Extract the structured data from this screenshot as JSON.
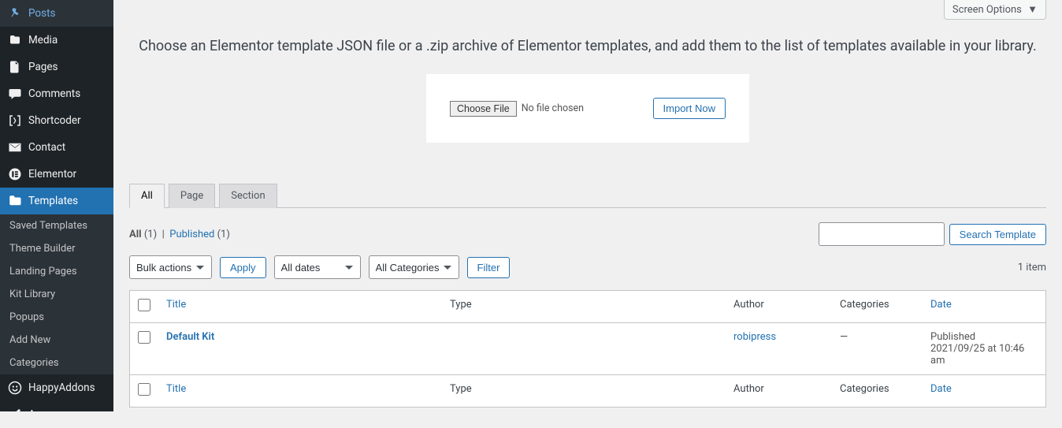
{
  "screen_options": "Screen Options",
  "sidebar": {
    "items": [
      {
        "icon": "pin",
        "label": "Posts"
      },
      {
        "icon": "media",
        "label": "Media"
      },
      {
        "icon": "page",
        "label": "Pages"
      },
      {
        "icon": "comment",
        "label": "Comments"
      },
      {
        "icon": "shortcoder",
        "label": "Shortcoder"
      },
      {
        "icon": "mail",
        "label": "Contact"
      },
      {
        "icon": "elementor",
        "label": "Elementor"
      },
      {
        "icon": "folder",
        "label": "Templates"
      },
      {
        "icon": "happy",
        "label": "HappyAddons"
      },
      {
        "icon": "brush",
        "label": "Appearance"
      }
    ],
    "submenu": [
      "Saved Templates",
      "Theme Builder",
      "Landing Pages",
      "Kit Library",
      "Popups",
      "Add New",
      "Categories"
    ]
  },
  "intro": "Choose an Elementor template JSON file or a .zip archive of Elementor templates, and add them to the list of templates available in your library.",
  "upload": {
    "choose_file": "Choose File",
    "no_file": "No file chosen",
    "import_btn": "Import Now"
  },
  "tabs": [
    {
      "label": "All",
      "active": true
    },
    {
      "label": "Page",
      "active": false
    },
    {
      "label": "Section",
      "active": false
    }
  ],
  "subsubs": {
    "all_label": "All",
    "all_count": "(1)",
    "sep": "|",
    "published_label": "Published",
    "published_count": "(1)"
  },
  "search": {
    "placeholder": "",
    "button": "Search Template"
  },
  "bulk": {
    "default": "Bulk actions",
    "apply": "Apply"
  },
  "filters": {
    "dates": "All dates",
    "cats": "All Categories",
    "filter_btn": "Filter"
  },
  "item_count": "1 item",
  "table": {
    "cols": {
      "title": "Title",
      "type": "Type",
      "author": "Author",
      "categories": "Categories",
      "date": "Date"
    },
    "rows": [
      {
        "title": "Default Kit",
        "type": "",
        "author": "robipress",
        "categories": "—",
        "date_status": "Published",
        "date_value": "2021/09/25 at 10:46 am"
      }
    ]
  }
}
